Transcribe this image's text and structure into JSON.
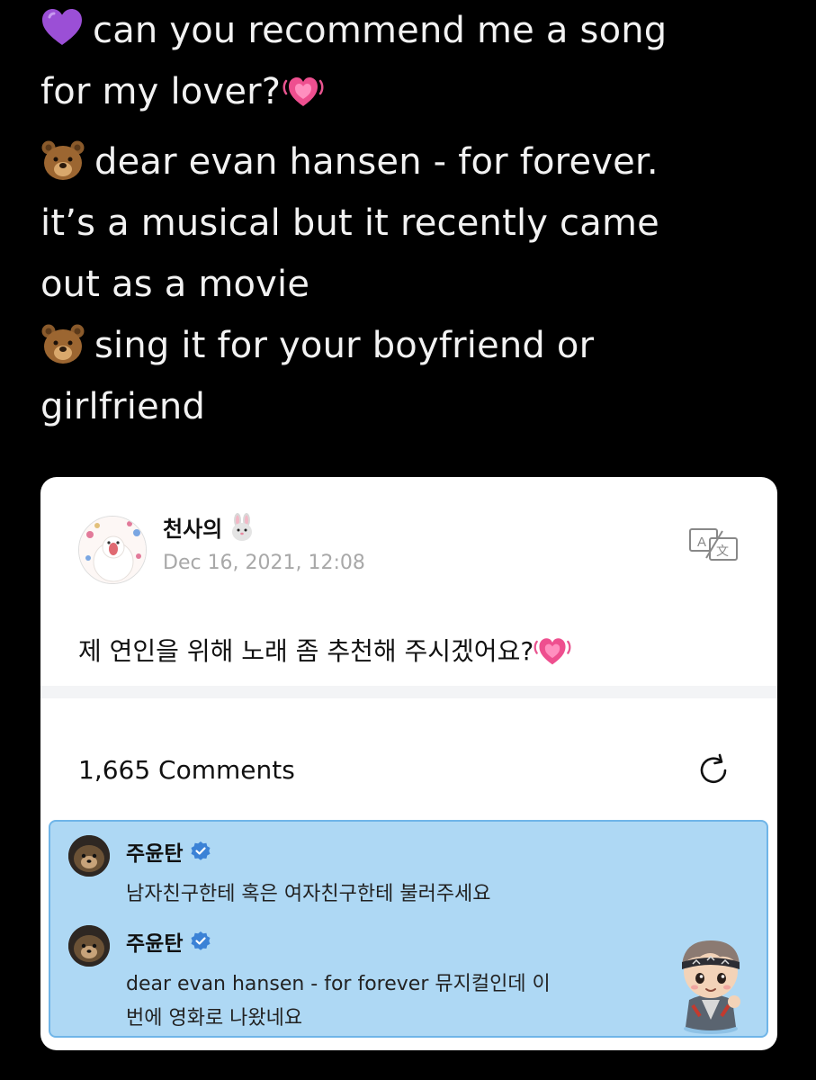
{
  "tweet": {
    "line1": "can you recommend me a song",
    "line2": "for my lover?",
    "line3": "dear evan hansen - for forever.",
    "line4": "it’s a musical but it recently came",
    "line5": "out as a movie",
    "line6": "sing it for your boyfriend or",
    "line7": "girlfriend",
    "emojis": [
      "purple-heart",
      "growing-heart",
      "bear-face",
      "bear-face"
    ]
  },
  "post": {
    "author": "천사의",
    "date": "Dec 16, 2021, 12:08",
    "body": "제 연인을 위해 노래 좀 추천해 주시겠어요?",
    "translate_icon": "translate-icon"
  },
  "comments": {
    "count_label": "1,665 Comments",
    "refresh_icon": "refresh-icon",
    "items": [
      {
        "author": "주윤탄",
        "text": "남자친구한테 혹은 여자친구한테 불러주세요"
      },
      {
        "author": "주윤탄",
        "text_line1": "dear evan hansen - for forever 뮤지컬인데 이",
        "text_line2": "번에 영화로 나왔네요"
      }
    ]
  },
  "colors": {
    "background": "#000000",
    "card": "#ffffff",
    "highlight": "#aed8f4",
    "highlight_border": "#6fb5e8",
    "verified": "#3b82d6",
    "date": "#a8a8a8"
  }
}
